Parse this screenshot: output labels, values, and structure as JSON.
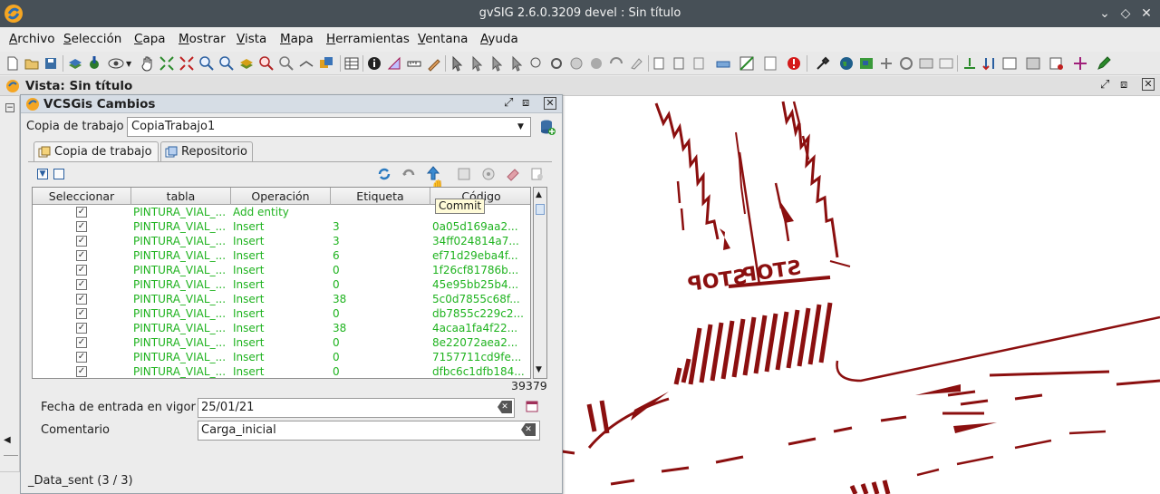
{
  "window": {
    "title": "gvSIG 2.6.0.3209 devel : Sin título"
  },
  "menu": {
    "items": [
      {
        "label": "Archivo",
        "mnemonic": "A",
        "rest": "rchivo"
      },
      {
        "label": "Selección",
        "mnemonic": "S",
        "rest": "elección"
      },
      {
        "label": "Capa",
        "mnemonic": "C",
        "rest": "apa"
      },
      {
        "label": "Mostrar",
        "mnemonic": "M",
        "rest": "ostrar"
      },
      {
        "label": "Vista",
        "mnemonic": "V",
        "rest": "ista"
      },
      {
        "label": "Mapa",
        "mnemonic": "M",
        "rest": "apa"
      },
      {
        "label": "Herramientas",
        "mnemonic": "H",
        "rest": "erramientas"
      },
      {
        "label": "Ventana",
        "mnemonic": "V",
        "rest": "entana"
      },
      {
        "label": "Ayuda",
        "mnemonic": "A",
        "rest": "yuda"
      }
    ]
  },
  "view": {
    "title": "Vista: Sin título"
  },
  "panel": {
    "title": "VCSGis Cambios",
    "working_copy_label": "Copia de trabajo",
    "working_copy_value": "CopiaTrabajo1",
    "tabs": [
      "Copia de trabajo",
      "Repositorio"
    ],
    "tooltip": "Commit",
    "columns": [
      "Seleccionar",
      "tabla",
      "Operación",
      "Etiqueta",
      "Código"
    ],
    "rows": [
      {
        "tabla": "PINTURA_VIAL_...",
        "op": "Add entity",
        "etiqueta": "",
        "codigo": ""
      },
      {
        "tabla": "PINTURA_VIAL_...",
        "op": "Insert",
        "etiqueta": "3",
        "codigo": "0a05d169aa2..."
      },
      {
        "tabla": "PINTURA_VIAL_...",
        "op": "Insert",
        "etiqueta": "3",
        "codigo": "34ff024814a7..."
      },
      {
        "tabla": "PINTURA_VIAL_...",
        "op": "Insert",
        "etiqueta": "6",
        "codigo": "ef71d29eba4f..."
      },
      {
        "tabla": "PINTURA_VIAL_...",
        "op": "Insert",
        "etiqueta": "0",
        "codigo": "1f26cf81786b..."
      },
      {
        "tabla": "PINTURA_VIAL_...",
        "op": "Insert",
        "etiqueta": "0",
        "codigo": "45e95bb25b4..."
      },
      {
        "tabla": "PINTURA_VIAL_...",
        "op": "Insert",
        "etiqueta": "38",
        "codigo": "5c0d7855c68f..."
      },
      {
        "tabla": "PINTURA_VIAL_...",
        "op": "Insert",
        "etiqueta": "0",
        "codigo": "db7855c229c2..."
      },
      {
        "tabla": "PINTURA_VIAL_...",
        "op": "Insert",
        "etiqueta": "38",
        "codigo": "4acaa1fa4f22..."
      },
      {
        "tabla": "PINTURA_VIAL_...",
        "op": "Insert",
        "etiqueta": "0",
        "codigo": "8e22072aea2..."
      },
      {
        "tabla": "PINTURA_VIAL_...",
        "op": "Insert",
        "etiqueta": "0",
        "codigo": "7157711cd9fe..."
      },
      {
        "tabla": "PINTURA_VIAL_...",
        "op": "Insert",
        "etiqueta": "0",
        "codigo": "dfbc6c1dfb184..."
      }
    ],
    "count": "39379",
    "date_label": "Fecha de entrada en vigor",
    "date_value": "25/01/21",
    "comment_label": "Comentario",
    "comment_value": "Carga_inicial"
  },
  "status": {
    "text": "_Data_sent (3 / 3)"
  },
  "map": {
    "stop_text": "STOP"
  },
  "colors": {
    "map_line": "#8b0f0f",
    "table_text": "#1fb31f",
    "titlebar": "#475057"
  }
}
